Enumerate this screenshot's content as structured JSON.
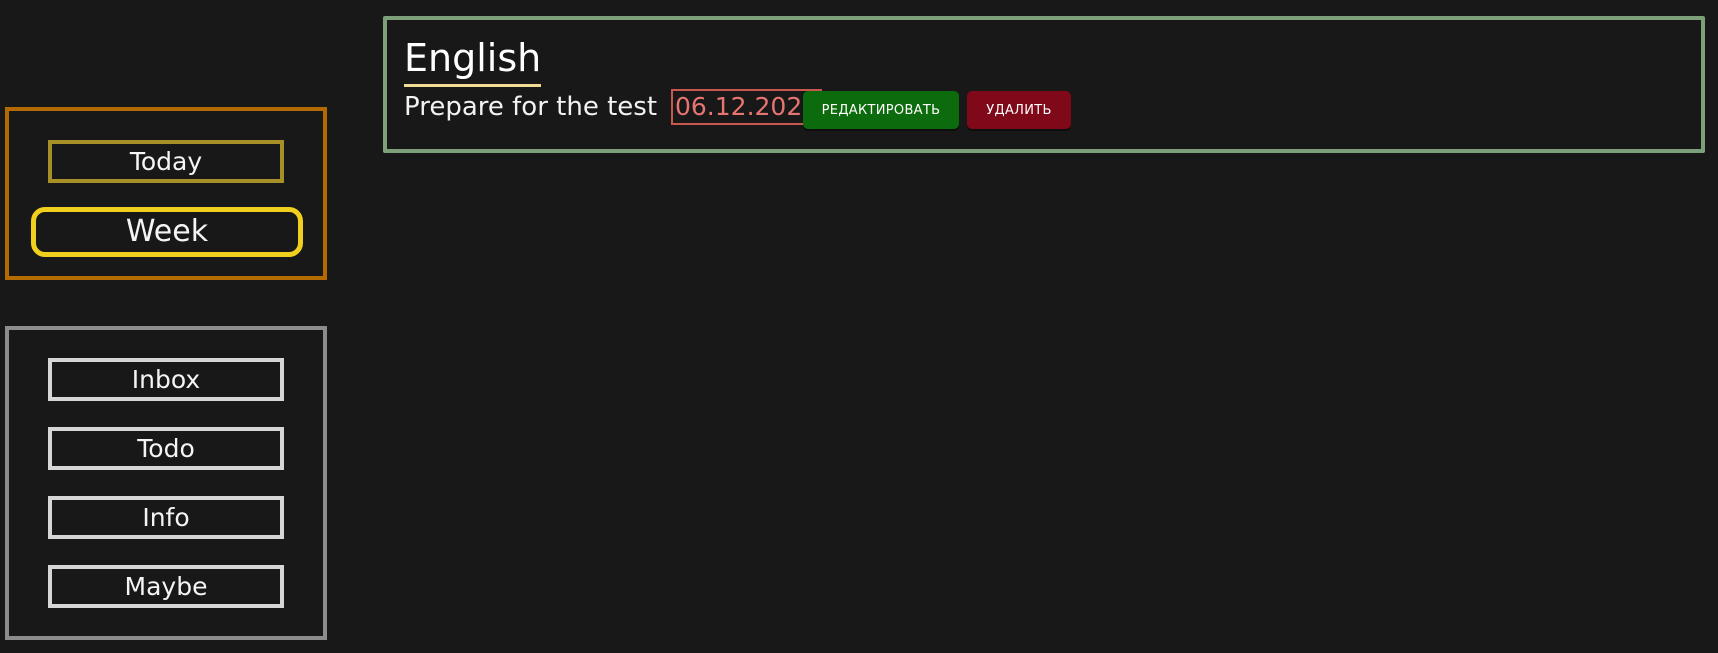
{
  "sidebar": {
    "time_filters": [
      {
        "label": "Today"
      },
      {
        "label": "Week"
      }
    ],
    "lists": [
      {
        "label": "Inbox"
      },
      {
        "label": "Todo"
      },
      {
        "label": "Info"
      },
      {
        "label": "Maybe"
      }
    ]
  },
  "task": {
    "title": "English",
    "description": "Prepare for the test",
    "date": "06.12.2022",
    "edit_label": "РЕДАКТИРОВАТЬ",
    "delete_label": "УДАЛИТЬ"
  },
  "colors": {
    "background": "#181818",
    "time_panel_border": "#b36b00",
    "list_panel_border": "#8c8c8c",
    "active_filter_border": "#f1cf1f",
    "task_card_border": "#7d9f7a",
    "date_color": "#e67470",
    "edit_button": "#0c6b0c",
    "delete_button": "#7f0819"
  }
}
